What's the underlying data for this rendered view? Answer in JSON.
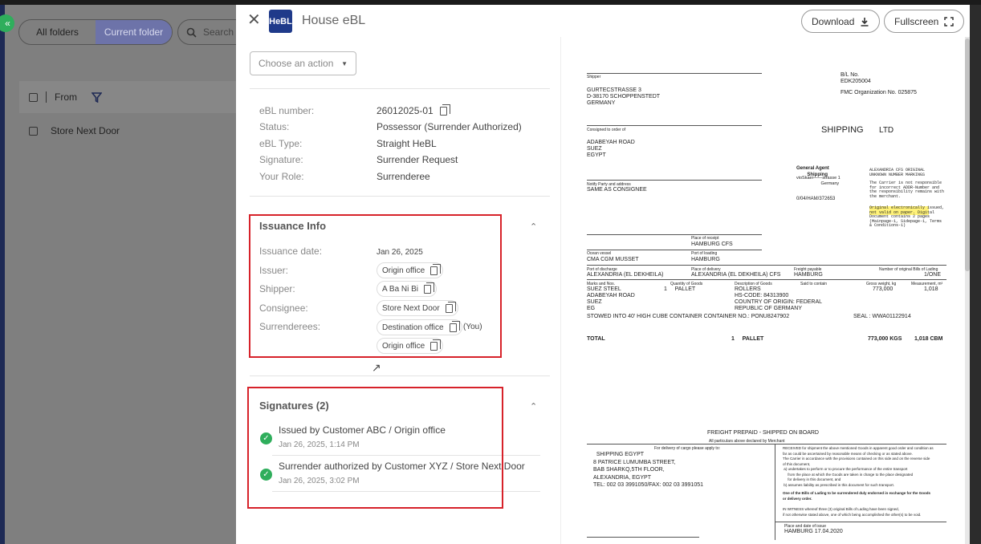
{
  "background": {
    "collapse_icon": "double-chevron-left-icon",
    "folder_toggle": [
      "All folders",
      "Current folder"
    ],
    "search_placeholder": "Search",
    "list_header": {
      "from": "From"
    },
    "rows": [
      {
        "from": "Store Next Door"
      }
    ]
  },
  "panel": {
    "logo": "HeBL",
    "title": "House eBL",
    "download_label": "Download",
    "fullscreen_label": "Fullscreen",
    "action_placeholder": "Choose an action",
    "details": [
      {
        "label": "eBL number:",
        "value": "26012025-01"
      },
      {
        "label": "Status:",
        "value": "Possessor (Surrender Authorized)"
      },
      {
        "label": "eBL Type:",
        "value": "Straight HeBL"
      },
      {
        "label": "Signature:",
        "value": "Surrender Request"
      },
      {
        "label": "Your Role:",
        "value": "Surrenderee"
      }
    ],
    "issuance": {
      "title": "Issuance Info",
      "date_label": "Issuance date:",
      "date_value": "Jan 26, 2025",
      "issuer_label": "Issuer:",
      "issuer_value": "Origin office",
      "shipper_label": "Shipper:",
      "shipper_value": "A Ba Ni Bi",
      "consignee_label": "Consignee:",
      "consignee_value": "Store Next Door",
      "surrenderees_label": "Surrenderees:",
      "surrenderee_1": "Destination office",
      "you_tag": "(You)",
      "surrenderee_2": "Origin office"
    },
    "signatures": {
      "title": "Signatures (2)",
      "items": [
        {
          "text": "Issued by Customer ABC / Origin office",
          "time": "Jan 26, 2025, 1:14 PM"
        },
        {
          "text": "Surrender authorized by Customer XYZ / Store Next Door",
          "time": "Jan 26, 2025, 3:02 PM"
        }
      ]
    }
  },
  "document": {
    "shipper_hdr": "Shipper",
    "shipper": "GURTECSTRASSE 3\nD-38170 SCHOPPENSTEDT\nGERMANY",
    "bl_no_label": "B/L No.",
    "bl_no": "EDK205004",
    "fmc": "FMC Organization No. 025875",
    "consigned_hdr": "Consigned to order of",
    "consignee": "ADABEYAH ROAD\nSUEZ\nEGYPT",
    "carrier_name": "SHIPPING",
    "carrier_ltd": "LTD",
    "general_agent": "General Agent\n        Shipping",
    "agent_addr": "vioSkaer——strasse 1\n                    Germany",
    "agent_ref": "0/04/HAM/372653",
    "notice_1": "ALEXANDRIA CFS ORIGINAL\nUNKNOWN NUMBER MARKINGS",
    "notice_2": "The Carrier is not responsible\nfor incorrect ADDR-Number and\nthe responsibility remains with\nthe merchant.",
    "notice_3": "Original electronically issued,\nnot valid on paper. Digital\nDocument contains 2 pages\n(Mainpage-1, Sidepage-1, Terms\n& Conditions-1)",
    "notify_hdr": "Notify Party and address",
    "notify": "SAME AS CONSIGNEE",
    "receipt_hdr": "Place of receipt",
    "receipt": "HAMBURG CFS",
    "vessel_hdr": "Ocean vessel",
    "vessel": "CMA CGM MUSSET",
    "loading_hdr": "Port of loading",
    "loading": "HAMBURG",
    "discharge_hdr": "Port of discharge",
    "discharge": "ALEXANDRIA (EL DEKHEILA)",
    "delivery_hdr": "Place of delivery",
    "delivery": "ALEXANDRIA (EL DEKHEILA) CFS",
    "freight_hdr": "Freight payable",
    "freight": "HAMBURG",
    "originals_hdr": "Number of original Bills of Lading",
    "originals": "1/ONE",
    "marks_hdr": "Marks and Nos.",
    "qty_hdr": "Quantity of Goods",
    "desc_hdr": "Description of Goods",
    "said_hdr": "Said to contain",
    "gross_hdr": "Gross weight, kg",
    "meas_hdr": "Measurement, m³",
    "marks": "SUEZ STEEL\nADABEYAH ROAD\nSUEZ\nEG",
    "qty": "1     PALLET",
    "desc": "ROLLERS\nHS-CODE: 84313900\nCOUNTRY OF ORIGIN: FEDERAL\nREPUBLIC OF GERMANY",
    "gross": "773,000",
    "meas": "1,018",
    "stowed": "STOWED INTO 40' HIGH CUBE CONTAINER CONTAINER NO.: PONU8247902",
    "seal": "SEAL : WWA01122914",
    "total_label": "TOTAL",
    "total_qty": "1     PALLET",
    "total_gross": "773,000 KGS",
    "total_meas": "1,018 CBM",
    "freight_prepaid": "FREIGHT PREPAID - SHIPPED ON BOARD",
    "particulars": "All particulars above declared by Merchant",
    "release_hdr": "For delivery of cargo please apply to:",
    "release": "  SHIPPING EGYPT\n8 PATRICE LUMUMBA STREET,\nBAB SHARKQ,5TH FLOOR,\nALEXANDRIA, EGYPT\nTEL: 002 03 3991050/FAX: 002 03 3991051",
    "terms": "RECEIVED for shipment the above mentioned Goods in apparent good order and condition as\nfar as could be ascertained by reasonable means of checking or as stated above.\nThe Carrier in accordance with the provisions contained on this side and on the reverse side\nof this document,\n a) undertakes to perform or to procure the performance of the entire transport\n     from the place at which the Goods are taken in charge to the place designated\n     for delivery in this document, and\n b) assumes liability as prescribed in this document for such transport.",
    "terms_bold": "One of the Bills of Lading to be surrendered duly endorsed in exchange for the Goods\nor delivery order.",
    "witness": "IN WITNESS whereof three (3) original Bills of Lading have been signed,\nif not otherwise stated above, one of which being accomplished the other(s) to be void.",
    "issue_hdr": "Place and date of issue",
    "issue": "HAMBURG 17.04.2020"
  }
}
